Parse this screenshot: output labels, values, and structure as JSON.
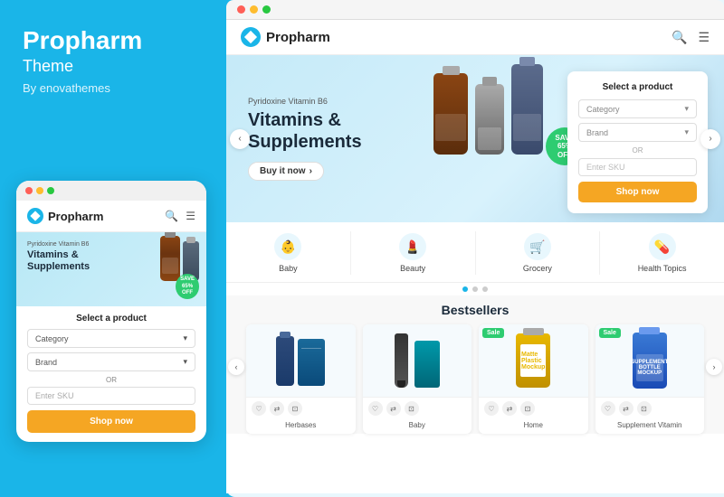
{
  "app": {
    "left_panel": {
      "title": "Propharm",
      "subtitle": "Theme",
      "by_line": "By enovathemes"
    },
    "mobile": {
      "logo": "Propharm",
      "hero_small": "Pyridoxine Vitamin B6",
      "hero_title": "Vitamins &\nSupplements",
      "select_title": "Select a product",
      "category_placeholder": "Category",
      "brand_placeholder": "Brand",
      "or_text": "OR",
      "sku_placeholder": "Enter SKU",
      "shop_btn": "Shop now"
    },
    "desktop": {
      "logo": "Propharm",
      "hero_small": "Pyridoxine Vitamin B6",
      "hero_title": "Vitamins &\nSupplements",
      "buy_btn": "Buy it now",
      "save_badge": "SAVE\n65% OFF",
      "side_card": {
        "title": "Select a product",
        "category_placeholder": "Category",
        "brand_placeholder": "Brand",
        "or_text": "OR",
        "sku_placeholder": "Enter SKU",
        "shop_btn": "Shop now"
      },
      "categories": [
        {
          "label": "Baby",
          "icon": "👶"
        },
        {
          "label": "Beauty",
          "icon": "💄"
        },
        {
          "label": "Grocery",
          "icon": "🛒"
        },
        {
          "label": "Health Topics",
          "icon": "💊"
        }
      ],
      "bestsellers_title": "Bestsellers",
      "products": [
        {
          "name": "Herbases",
          "sale": false
        },
        {
          "name": "Baby",
          "sale": false
        },
        {
          "name": "Home",
          "sale": true
        },
        {
          "name": "Supplement Vitamin",
          "sale": true
        }
      ]
    },
    "colors": {
      "primary": "#1ab5e8",
      "orange": "#f5a623",
      "green": "#2ecc71",
      "dark": "#1a2a3a",
      "light_blue_bg": "#c5eaf8"
    }
  }
}
